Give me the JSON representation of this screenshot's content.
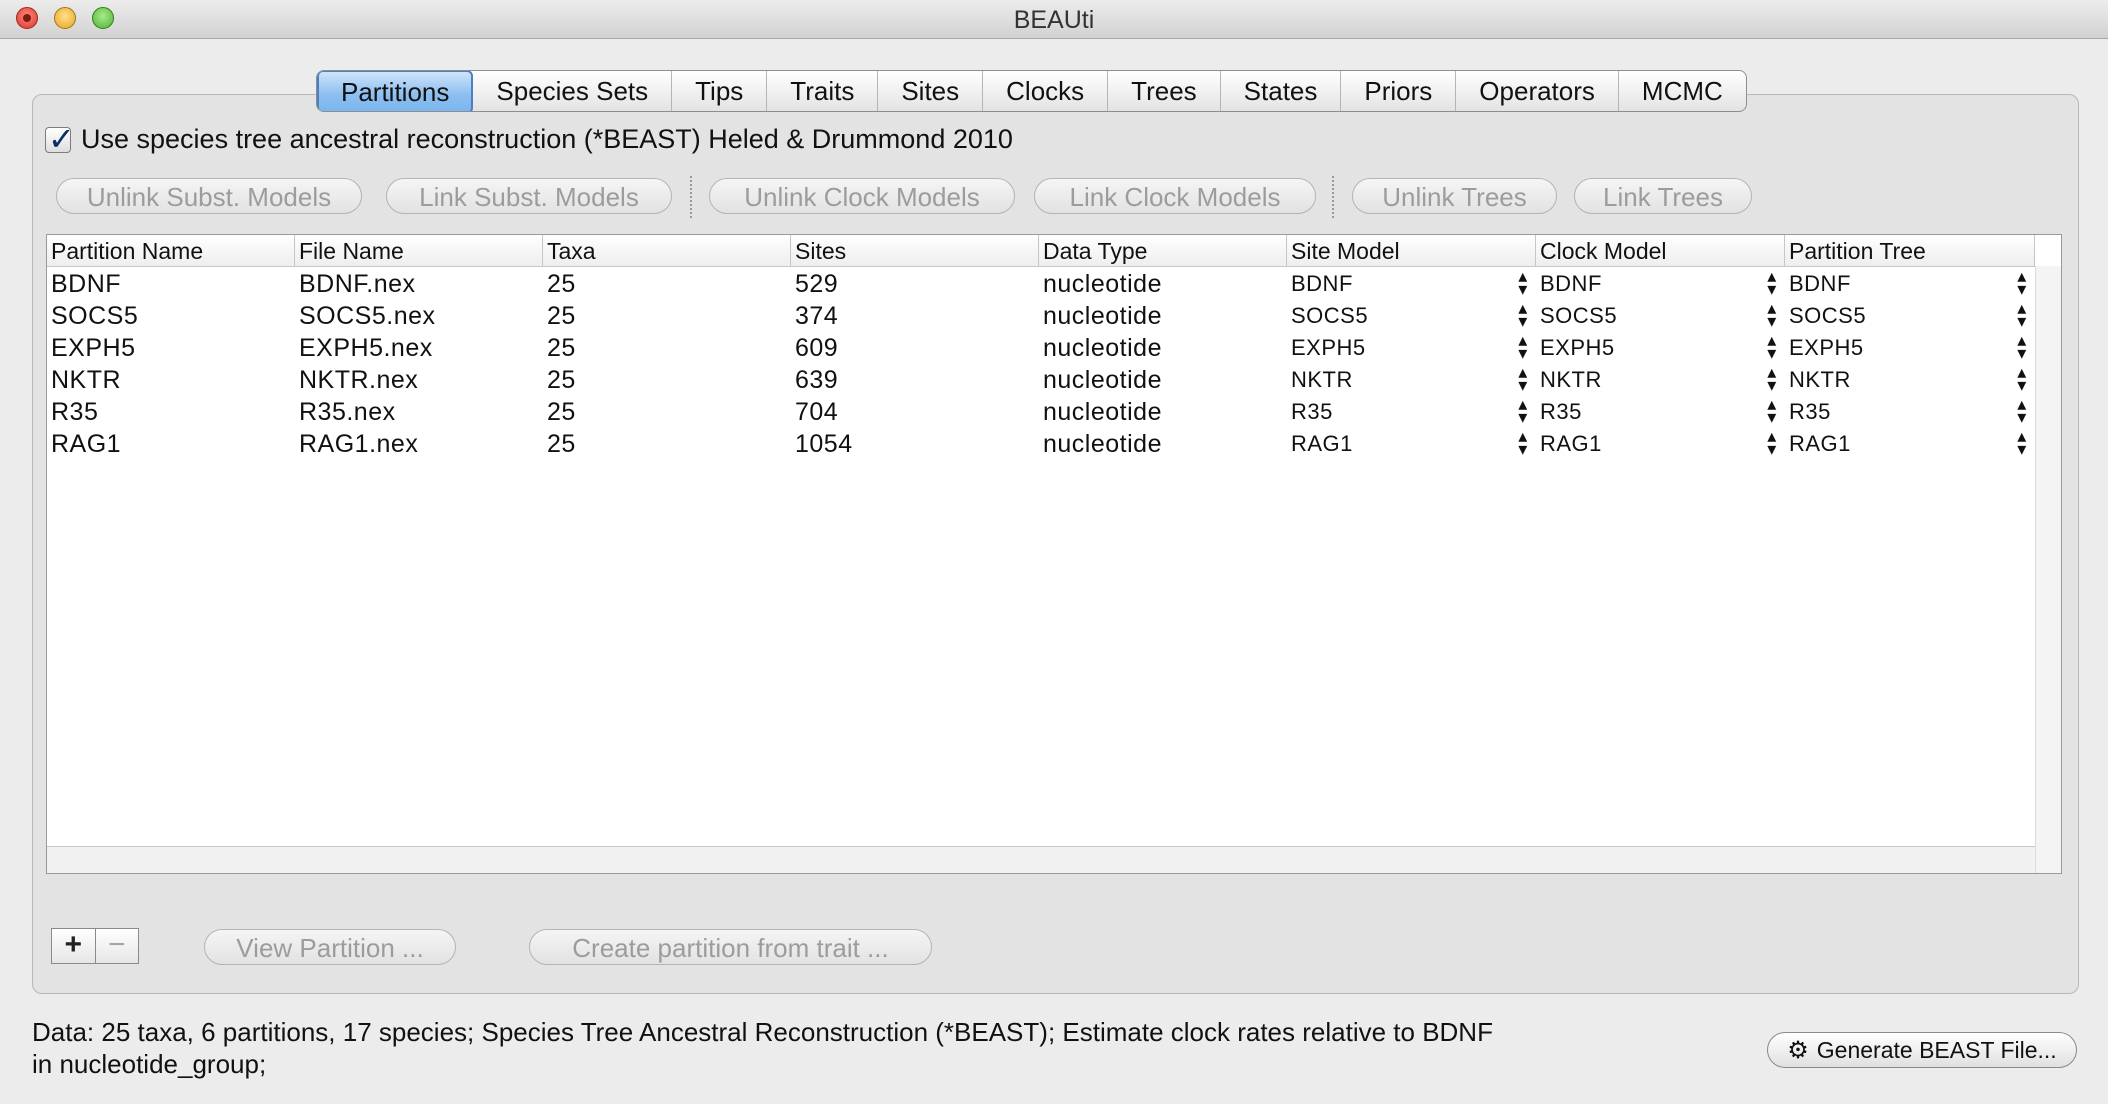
{
  "window": {
    "title": "BEAUti"
  },
  "tabs": [
    {
      "label": "Partitions",
      "active": true
    },
    {
      "label": "Species Sets"
    },
    {
      "label": "Tips"
    },
    {
      "label": "Traits"
    },
    {
      "label": "Sites"
    },
    {
      "label": "Clocks"
    },
    {
      "label": "Trees"
    },
    {
      "label": "States"
    },
    {
      "label": "Priors"
    },
    {
      "label": "Operators"
    },
    {
      "label": "MCMC"
    }
  ],
  "species_tree": {
    "checked": true,
    "label": "Use species tree ancestral reconstruction (*BEAST) Heled & Drummond 2010"
  },
  "link_buttons": {
    "unlink_subst": "Unlink Subst. Models",
    "link_subst": "Link Subst. Models",
    "unlink_clock": "Unlink Clock Models",
    "link_clock": "Link Clock Models",
    "unlink_trees": "Unlink Trees",
    "link_trees": "Link Trees"
  },
  "table": {
    "columns": [
      "Partition Name",
      "File Name",
      "Taxa",
      "Sites",
      "Data Type",
      "Site Model",
      "Clock Model",
      "Partition Tree"
    ],
    "rows": [
      [
        "BDNF",
        "BDNF.nex",
        "25",
        "529",
        "nucleotide",
        "BDNF",
        "BDNF",
        "BDNF"
      ],
      [
        "SOCS5",
        "SOCS5.nex",
        "25",
        "374",
        "nucleotide",
        "SOCS5",
        "SOCS5",
        "SOCS5"
      ],
      [
        "EXPH5",
        "EXPH5.nex",
        "25",
        "609",
        "nucleotide",
        "EXPH5",
        "EXPH5",
        "EXPH5"
      ],
      [
        "NKTR",
        "NKTR.nex",
        "25",
        "639",
        "nucleotide",
        "NKTR",
        "NKTR",
        "NKTR"
      ],
      [
        "R35",
        "R35.nex",
        "25",
        "704",
        "nucleotide",
        "R35",
        "R35",
        "R35"
      ],
      [
        "RAG1",
        "RAG1.nex",
        "25",
        "1054",
        "nucleotide",
        "RAG1",
        "RAG1",
        "RAG1"
      ]
    ]
  },
  "controls": {
    "plus": "+",
    "minus": "−",
    "view_partition": "View Partition ...",
    "create_partition": "Create partition from trait ..."
  },
  "status": {
    "line1": "Data: 25 taxa, 6 partitions, 17 species; Species Tree Ancestral Reconstruction (*BEAST); Estimate clock rates relative to BDNF",
    "line2": "in nucleotide_group;"
  },
  "generate_button": {
    "label": "Generate BEAST File...",
    "icon": "gear-icon"
  }
}
